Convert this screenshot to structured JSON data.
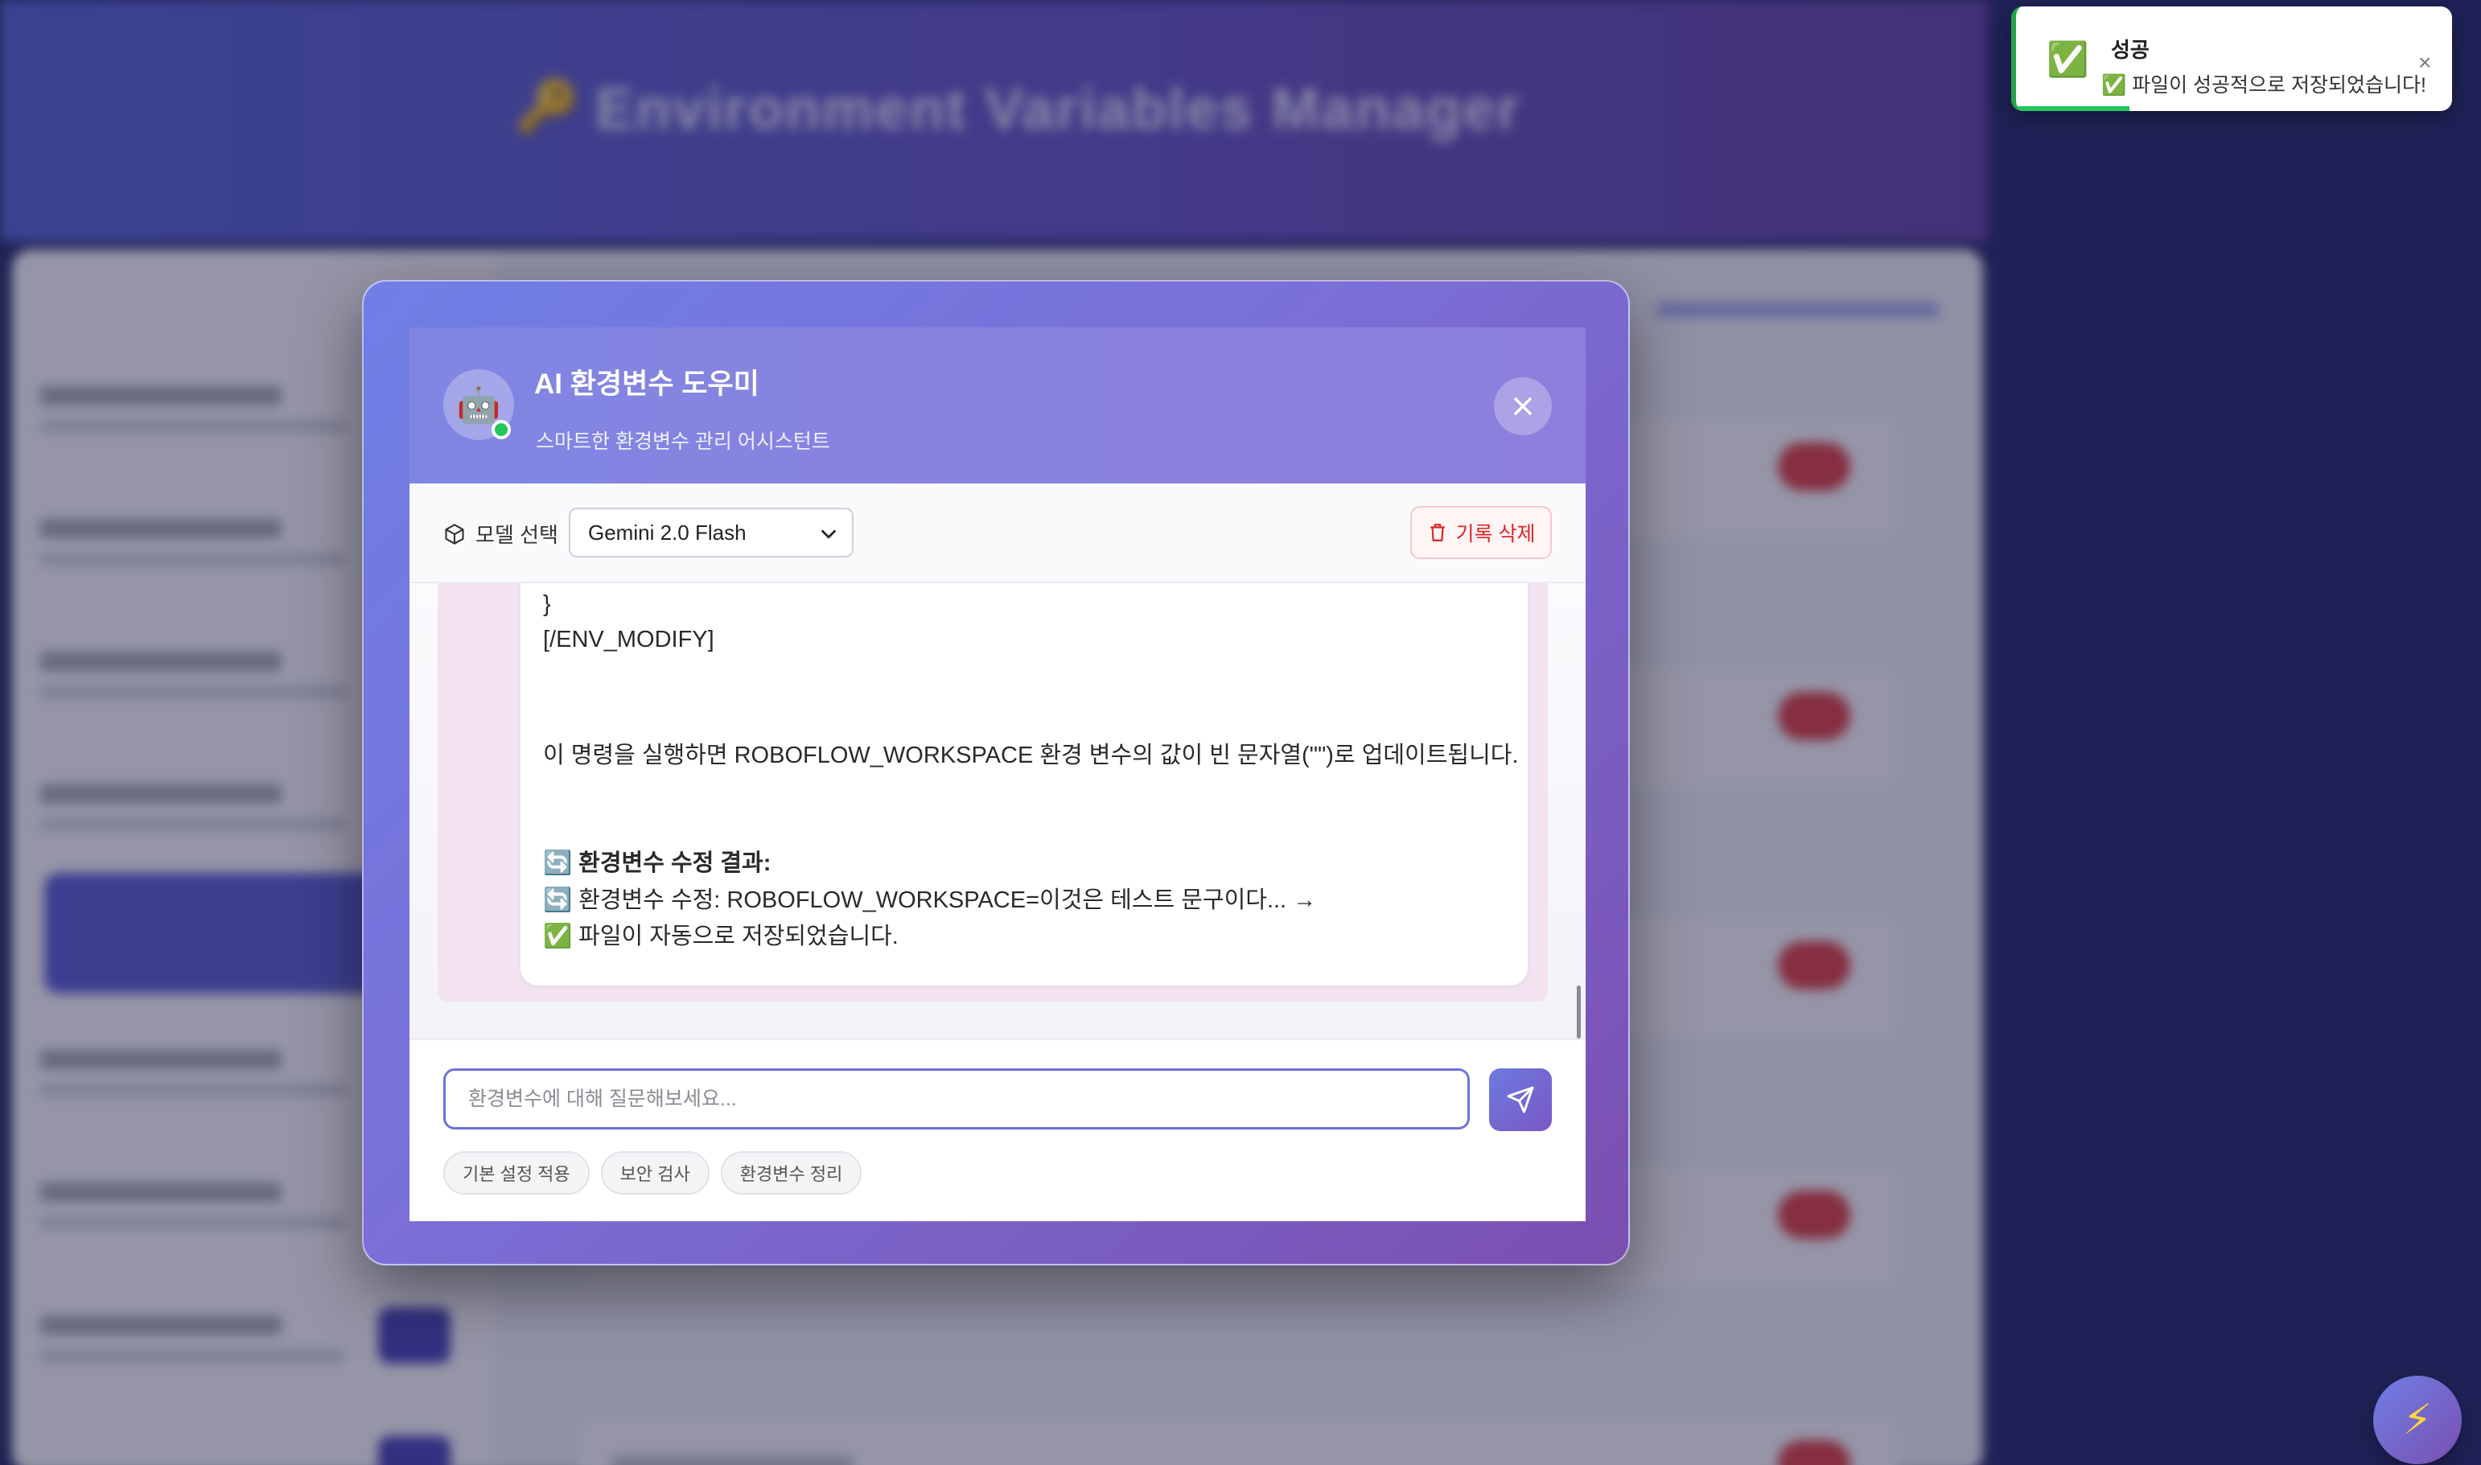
{
  "background": {
    "hero_title": "Environment Variables Manager",
    "hero_icon": "key-icon"
  },
  "modal": {
    "title": "AI 환경변수 도우미",
    "subtitle": "스마트한 환경변수 관리 어시스턴트",
    "avatar_icon": "🤖",
    "close_icon": "close-icon",
    "model_label": "모델 선택",
    "model_selected": "Gemini 2.0 Flash",
    "clear_label": "기록 삭제",
    "message": {
      "line_brace": "}",
      "line_tag": "[/ENV_MODIFY]",
      "line_desc": "이 명령을 실행하면 ROBOFLOW_WORKSPACE 환경 변수의 값이 빈 문자열(\"\")로 업데이트됩니다.",
      "result_heading": "🔄 환경변수 수정 결과:",
      "result_line1": "🔄 환경변수 수정: ROBOFLOW_WORKSPACE=이것은 테스트 문구이다... →",
      "result_line2": "✅ 파일이 자동으로 저장되었습니다."
    },
    "input_placeholder": "환경변수에 대해 질문해보세요...",
    "quick_actions": [
      "기본 설정 적용",
      "보안 검사",
      "환경변수 정리"
    ]
  },
  "toast": {
    "title": "성공",
    "message": "✅ 파일이 성공적으로 저장되었습니다!",
    "icon": "✅",
    "close_glyph": "×",
    "progress_fraction": 0.26,
    "accent": "#22c55e"
  },
  "fab_icon": "⚡",
  "colors": {
    "accent": "#6f73d8",
    "danger": "#dc2626",
    "success": "#22c55e"
  }
}
